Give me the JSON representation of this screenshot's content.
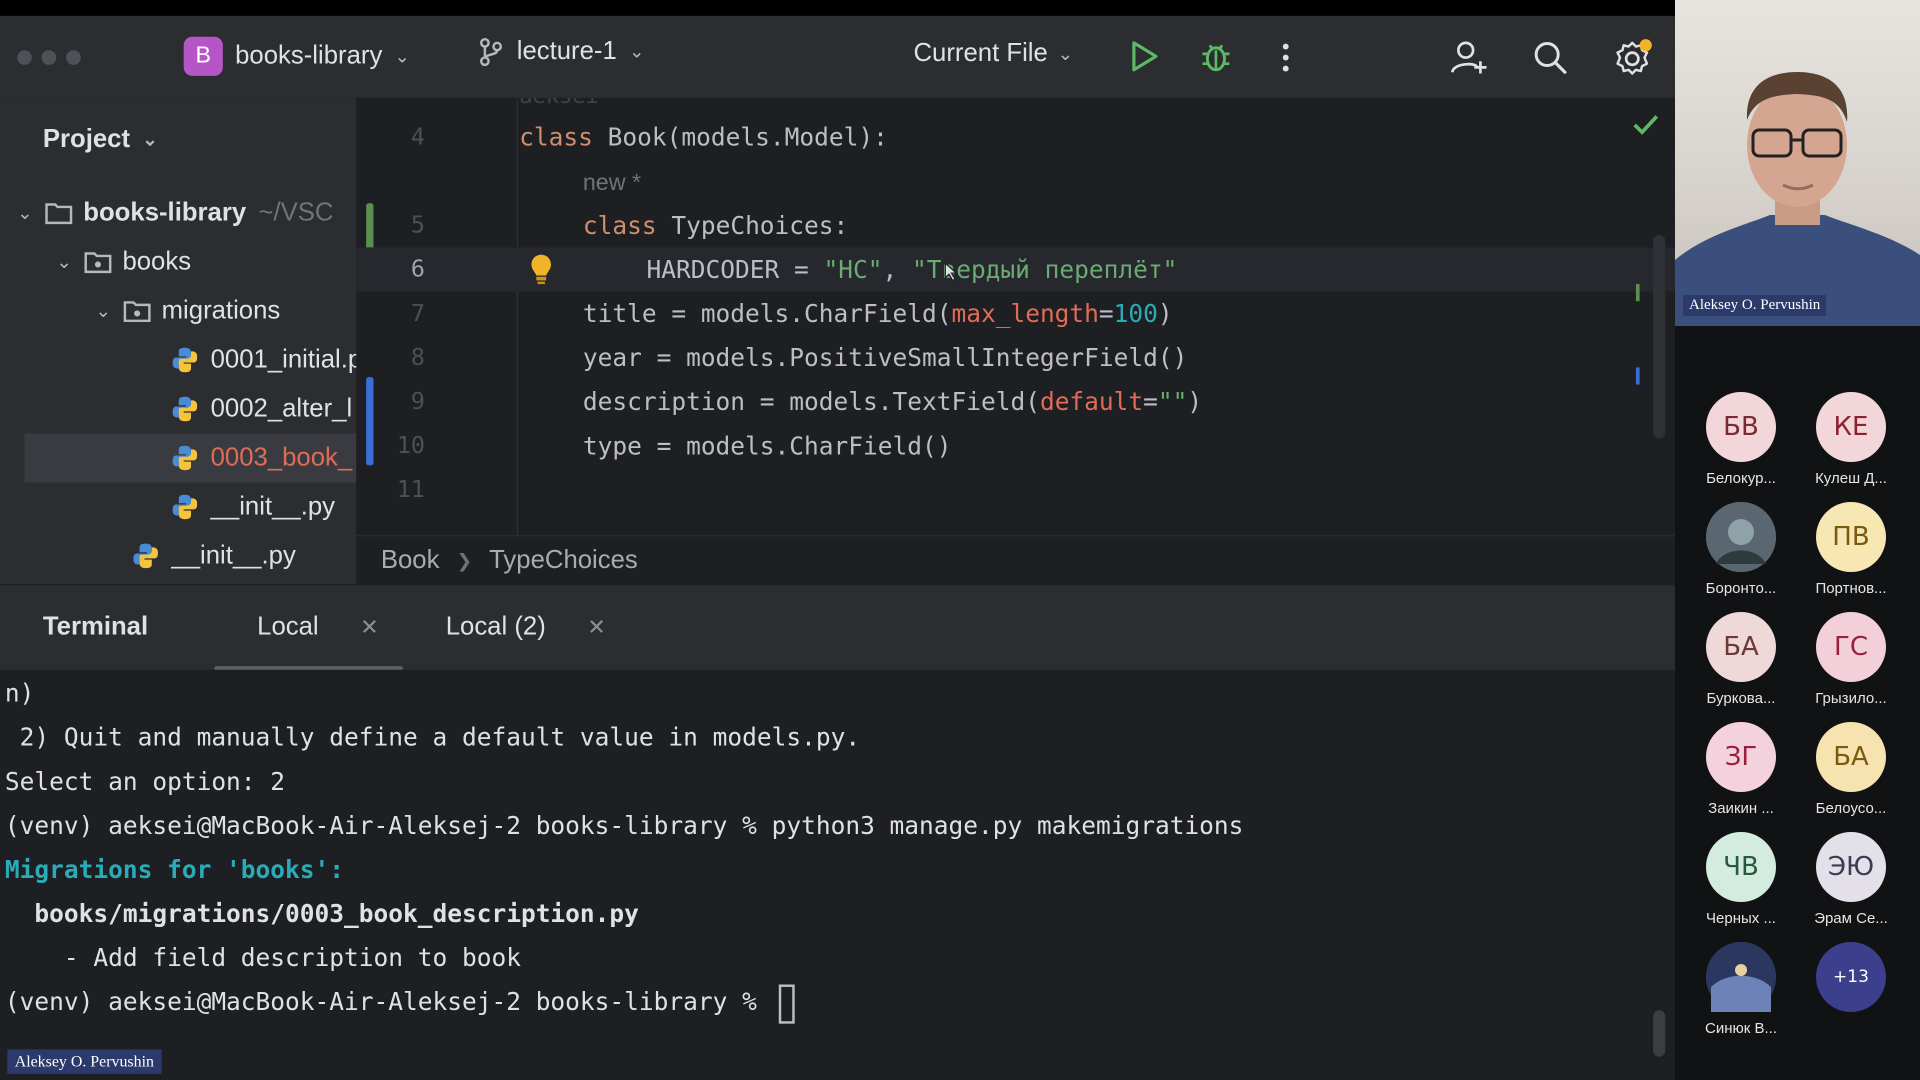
{
  "window": {
    "project_badge": "B",
    "project_name": "books-library",
    "branch": "lecture-1",
    "run_config": "Current File"
  },
  "sidebar": {
    "title": "Project",
    "rows": [
      {
        "label": "books-library",
        "path": "~/VSC"
      },
      {
        "label": "books"
      },
      {
        "label": "migrations"
      },
      {
        "label": "0001_initial.p"
      },
      {
        "label": "0002_alter_l"
      },
      {
        "label": "0003_book_"
      },
      {
        "label": "__init__.py"
      },
      {
        "label": "__init__.py"
      }
    ]
  },
  "editor": {
    "ghost_text": "aeksei",
    "inlay_hint": "new *",
    "line_numbers": [
      "4",
      "5",
      "6",
      "7",
      "8",
      "9",
      "10",
      "11"
    ],
    "lines": {
      "l4": {
        "kw": "class",
        "rest": " Book(models.Model):"
      },
      "l5": {
        "kw": "class",
        "rest": " TypeChoices:"
      },
      "l6": {
        "a": "HARDCODER = ",
        "s1": "\"HC\"",
        "b": ", ",
        "s2": "\"Твердый переплёт\""
      },
      "l7": {
        "a": "title = models.CharField(",
        "p": "max_length",
        "b": "=",
        "n": "100",
        "c": ")"
      },
      "l8": {
        "a": "year = models.PositiveSmallIntegerField()"
      },
      "l9": {
        "a": "description = models.TextField(",
        "p": "default",
        "b": "=",
        "s": "\"\"",
        "c": ")"
      },
      "l10": {
        "a": "type = models.CharField()"
      }
    },
    "breadcrumbs": [
      "Book",
      "TypeChoices"
    ]
  },
  "terminal": {
    "title": "Terminal",
    "tabs": [
      "Local",
      "Local (2)"
    ],
    "lines": [
      "n)",
      " 2) Quit and manually define a default value in models.py.",
      "Select an option: 2",
      "(venv) aeksei@MacBook-Air-Aleksej-2 books-library % python3 manage.py makemigrations",
      "Migrations for 'books':",
      "  books/migrations/0003_book_description.py",
      "    - Add field description to book",
      "(venv) aeksei@MacBook-Air-Aleksej-2 books-library % "
    ],
    "presenter_label": "Aleksey O. Pervushin"
  },
  "meeting": {
    "speaker_name": "Aleksey O. Pervushin",
    "participants": [
      {
        "initials": "БВ",
        "name": "Белокур...",
        "bg": "#f3d6d9",
        "fg": "#7a2a33"
      },
      {
        "initials": "КЕ",
        "name": "Кулеш Д...",
        "bg": "#f3d6d9",
        "fg": "#8a2232"
      },
      {
        "initials": "",
        "name": "Боронто...",
        "bg": "#55606a",
        "fg": "#ffffff"
      },
      {
        "initials": "ПВ",
        "name": "Портнов...",
        "bg": "#f7e7b3",
        "fg": "#7a5a10"
      },
      {
        "initials": "БА",
        "name": "Буркова...",
        "bg": "#eed9d8",
        "fg": "#6b3a36"
      },
      {
        "initials": "ГС",
        "name": "Грызило...",
        "bg": "#f3d0d9",
        "fg": "#9b1f3d"
      },
      {
        "initials": "ЗГ",
        "name": "Заикин ...",
        "bg": "#f4d2dd",
        "fg": "#9b1f3d"
      },
      {
        "initials": "БА",
        "name": "Белоусо...",
        "bg": "#f7e3b0",
        "fg": "#7a5a10"
      },
      {
        "initials": "ЧВ",
        "name": "Черных ...",
        "bg": "#d3ecdf",
        "fg": "#245a3d"
      },
      {
        "initials": "ЭЮ",
        "name": "Эрам Се...",
        "bg": "#e3e0ea",
        "fg": "#3d3a52"
      },
      {
        "initials": "",
        "name": "Синюк В...",
        "bg": "#3a4a7a",
        "fg": "#ffffff"
      },
      {
        "initials": "+13",
        "name": "",
        "bg": "#3c3f8c",
        "fg": "#ffffff"
      }
    ]
  },
  "colors": {
    "keyword": "#cf8e6d",
    "string": "#6aab73",
    "number": "#2aacb8",
    "param": "#e06c57",
    "run_green": "#5fb865"
  }
}
